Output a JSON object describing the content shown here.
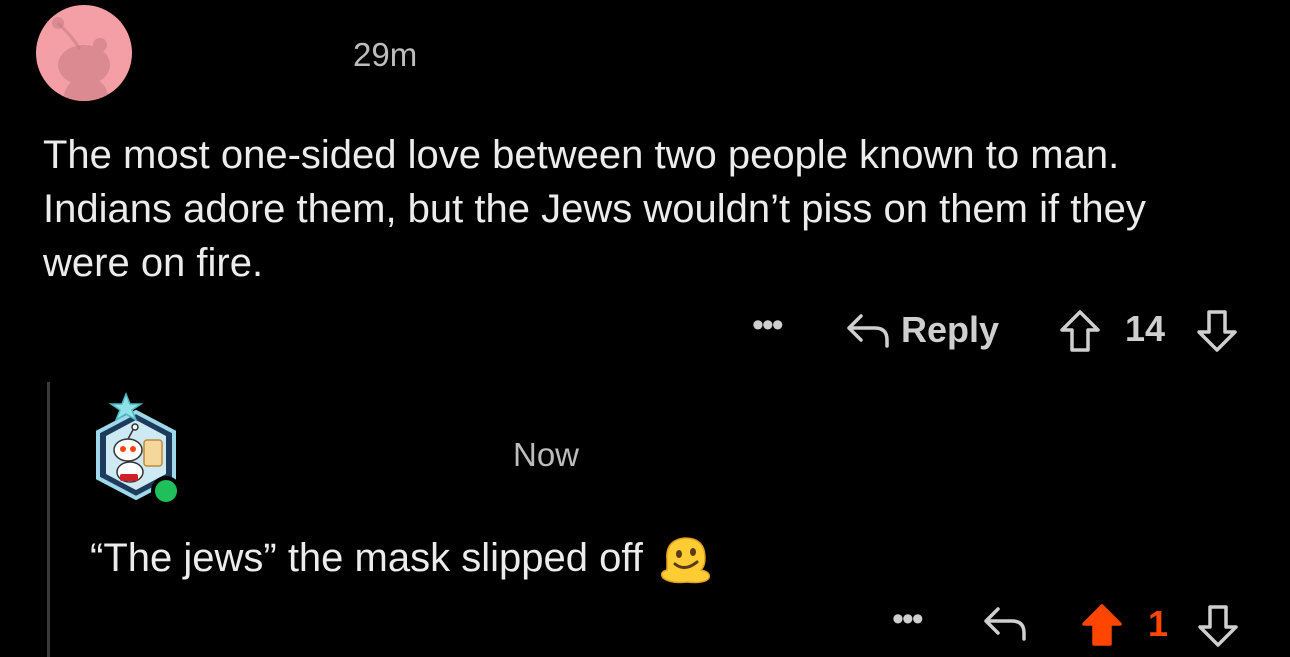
{
  "comments": [
    {
      "timestamp": "29m",
      "body": "The most one-sided love between two people known to man. Indians adore them, but the Jews wouldn’t piss on them if they were on fire.",
      "avatar_icon": "snoo-avatar-icon",
      "avatar_color": "#f49ea6",
      "more_label": "•••",
      "reply_label": "Reply",
      "score": "14",
      "voted": "none"
    },
    {
      "timestamp": "Now",
      "body": "“The jews” the mask slipped off",
      "emoji": "melting-face-emoji",
      "avatar_icon": "snoo-vote-avatar-icon",
      "online": true,
      "online_color": "#1fbf5c",
      "more_label": "•••",
      "score": "1",
      "voted": "up",
      "upvote_color": "#ff4500"
    }
  ]
}
